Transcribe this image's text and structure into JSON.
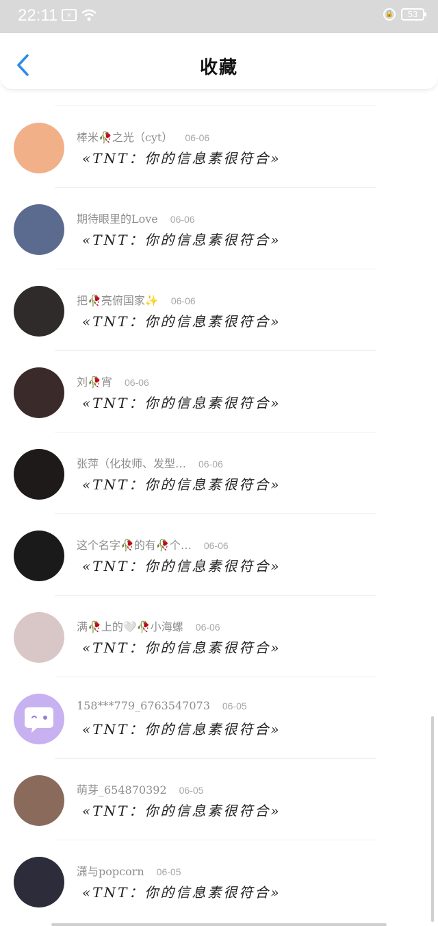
{
  "status_bar": {
    "time": "22:11",
    "battery": "53"
  },
  "header": {
    "title": "收藏"
  },
  "items": [
    {
      "name": "棒米🥀之光（cyt）",
      "date": "06-06",
      "message": "«TNT：你的信息素很符合»",
      "avatar_color": "#f2b089"
    },
    {
      "name": "期待眼里的Love",
      "date": "06-06",
      "message": "«TNT：你的信息素很符合»",
      "avatar_color": "#5b6a8f"
    },
    {
      "name": "把🥀亮俯国家✨",
      "date": "06-06",
      "message": "«TNT：你的信息素很符合»",
      "avatar_color": "#2f2b2b"
    },
    {
      "name": "刘🥀宵",
      "date": "06-06",
      "message": "«TNT：你的信息素很符合»",
      "avatar_color": "#3a2a2a"
    },
    {
      "name": "张萍（化妆师、发型…",
      "date": "06-06",
      "message": "«TNT：你的信息素很符合»",
      "avatar_color": "#1e1a1a"
    },
    {
      "name": "这个名字🥀的有🥀个…",
      "date": "06-06",
      "message": "«TNT：你的信息素很符合»",
      "avatar_color": "#1a1a1a"
    },
    {
      "name": "满🥀上的🤍🥀小海螺",
      "date": "06-06",
      "message": "«TNT：你的信息素很符合»",
      "avatar_color": "#d9c7c7"
    },
    {
      "name": "158***779_6763547073",
      "date": "06-05",
      "message": "«TNT：你的信息素很符合»",
      "avatar_color": "#c8b1f0"
    },
    {
      "name": "萌芽_654870392",
      "date": "06-05",
      "message": "«TNT：你的信息素很符合»",
      "avatar_color": "#8a6b5b"
    },
    {
      "name": "潇与popcorn",
      "date": "06-05",
      "message": "«TNT：你的信息素很符合»",
      "avatar_color": "#2c2c3a"
    }
  ]
}
